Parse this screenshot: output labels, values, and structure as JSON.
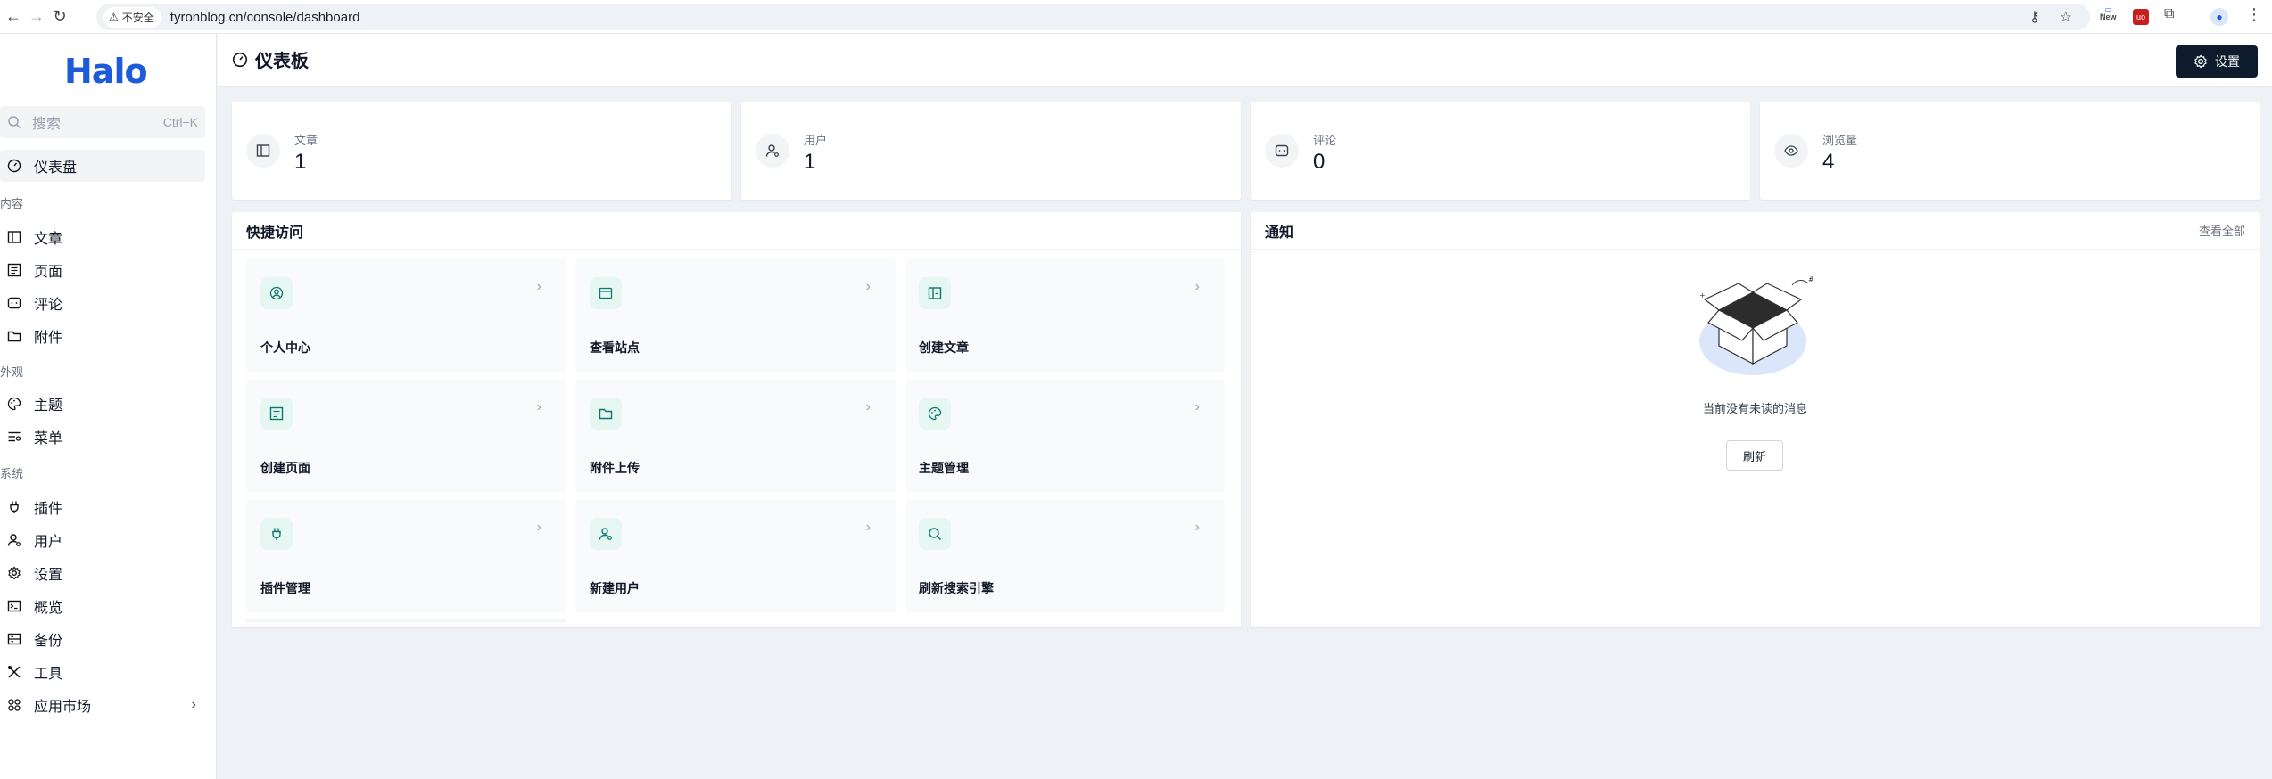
{
  "browser": {
    "security_label": "不安全",
    "url": "tyronblog.cn/console/dashboard",
    "ext_new_label": "New"
  },
  "sidebar": {
    "logo": "Halo",
    "search_placeholder": "搜索",
    "search_shortcut": "Ctrl+K",
    "dashboard_label": "仪表盘",
    "groups": {
      "content": "内容",
      "appearance": "外观",
      "system": "系统"
    },
    "items": {
      "posts": "文章",
      "pages": "页面",
      "comments": "评论",
      "attachments": "附件",
      "themes": "主题",
      "menus": "菜单",
      "plugins": "插件",
      "users": "用户",
      "settings": "设置",
      "overview": "概览",
      "backup": "备份",
      "tools": "工具",
      "marketplace": "应用市场"
    }
  },
  "header": {
    "title": "仪表板",
    "settings_button": "设置"
  },
  "stats": [
    {
      "label": "文章",
      "value": "1",
      "icon": "post-icon"
    },
    {
      "label": "用户",
      "value": "1",
      "icon": "user-icon"
    },
    {
      "label": "评论",
      "value": "0",
      "icon": "comment-icon"
    },
    {
      "label": "浏览量",
      "value": "4",
      "icon": "eye-icon"
    }
  ],
  "quick_access": {
    "title": "快捷访问",
    "tiles": [
      {
        "label": "个人中心",
        "icon": "user-circle-icon"
      },
      {
        "label": "查看站点",
        "icon": "browser-icon"
      },
      {
        "label": "创建文章",
        "icon": "post-icon"
      },
      {
        "label": "创建页面",
        "icon": "page-icon"
      },
      {
        "label": "附件上传",
        "icon": "folder-icon"
      },
      {
        "label": "主题管理",
        "icon": "palette-icon"
      },
      {
        "label": "插件管理",
        "icon": "plug-icon"
      },
      {
        "label": "新建用户",
        "icon": "user-add-icon"
      },
      {
        "label": "刷新搜索引擎",
        "icon": "search-icon"
      }
    ]
  },
  "notifications": {
    "title": "通知",
    "view_all": "查看全部",
    "empty_text": "当前没有未读的消息",
    "refresh_button": "刷新"
  },
  "colors": {
    "brand": "#1e5bd8",
    "dark_button": "#0e1b2c",
    "tile_icon_bg": "#e6f7f1",
    "tile_icon_fg": "#0f766e"
  }
}
